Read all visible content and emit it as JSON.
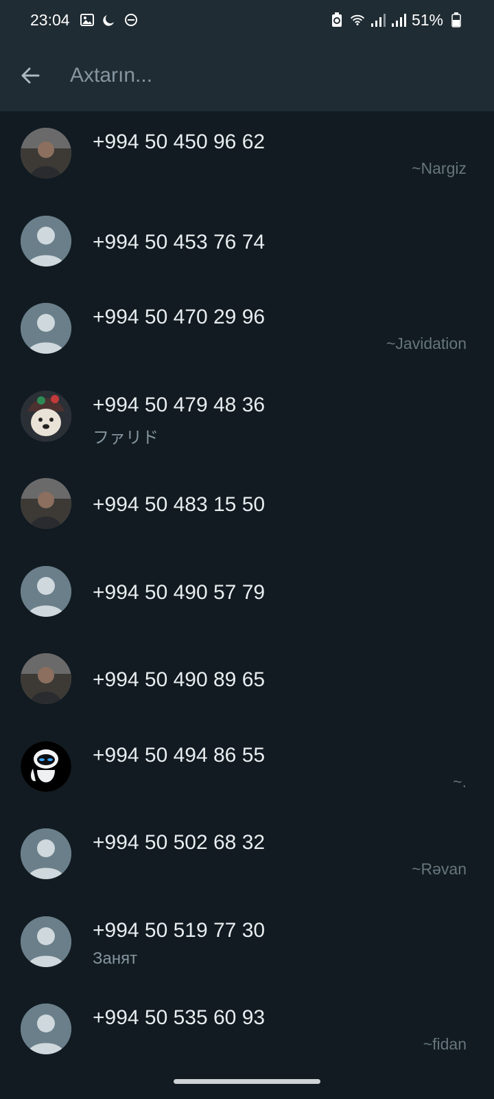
{
  "status_bar": {
    "time": "23:04",
    "battery": "51%",
    "icons_left": [
      "image-icon",
      "moon-icon",
      "dnd-icon"
    ],
    "icons_right": [
      "battery-saver-icon",
      "wifi-icon",
      "signal-icon",
      "signal-icon",
      "battery-icon"
    ]
  },
  "search": {
    "placeholder": "Axtarın...",
    "value": ""
  },
  "contacts": [
    {
      "phone": "+994 50 450 96 62",
      "sub": "",
      "right": "~Nargiz",
      "avatar": "photo-avatar"
    },
    {
      "phone": "+994 50 453 76 74",
      "sub": "",
      "right": "",
      "avatar": "default-avatar"
    },
    {
      "phone": "+994 50 470 29 96",
      "sub": "",
      "right": "~Javidation",
      "avatar": "default-avatar"
    },
    {
      "phone": "+994 50 479 48 36",
      "sub": "ファリド",
      "right": "",
      "avatar": "dog-avatar"
    },
    {
      "phone": "+994 50 483 15 50",
      "sub": "",
      "right": "",
      "avatar": "photo-avatar"
    },
    {
      "phone": "+994 50 490 57 79",
      "sub": "",
      "right": "",
      "avatar": "default-avatar"
    },
    {
      "phone": "+994 50 490 89 65",
      "sub": "",
      "right": "",
      "avatar": "photo-avatar"
    },
    {
      "phone": "+994 50 494 86 55",
      "sub": "",
      "right": "~.",
      "avatar": "robot-avatar"
    },
    {
      "phone": "+994 50 502 68 32",
      "sub": "",
      "right": "~Rəvan",
      "avatar": "default-avatar"
    },
    {
      "phone": "+994 50 519 77 30",
      "sub": "Занят",
      "right": "",
      "avatar": "default-avatar"
    },
    {
      "phone": "+994 50 535 60 93",
      "sub": "",
      "right": "~fidan",
      "avatar": "default-avatar"
    }
  ],
  "colors": {
    "background": "#111b21",
    "header": "#202c33",
    "text_primary": "#e9edef",
    "text_secondary": "#8696a0",
    "avatar_default": "#6a7f8a"
  }
}
